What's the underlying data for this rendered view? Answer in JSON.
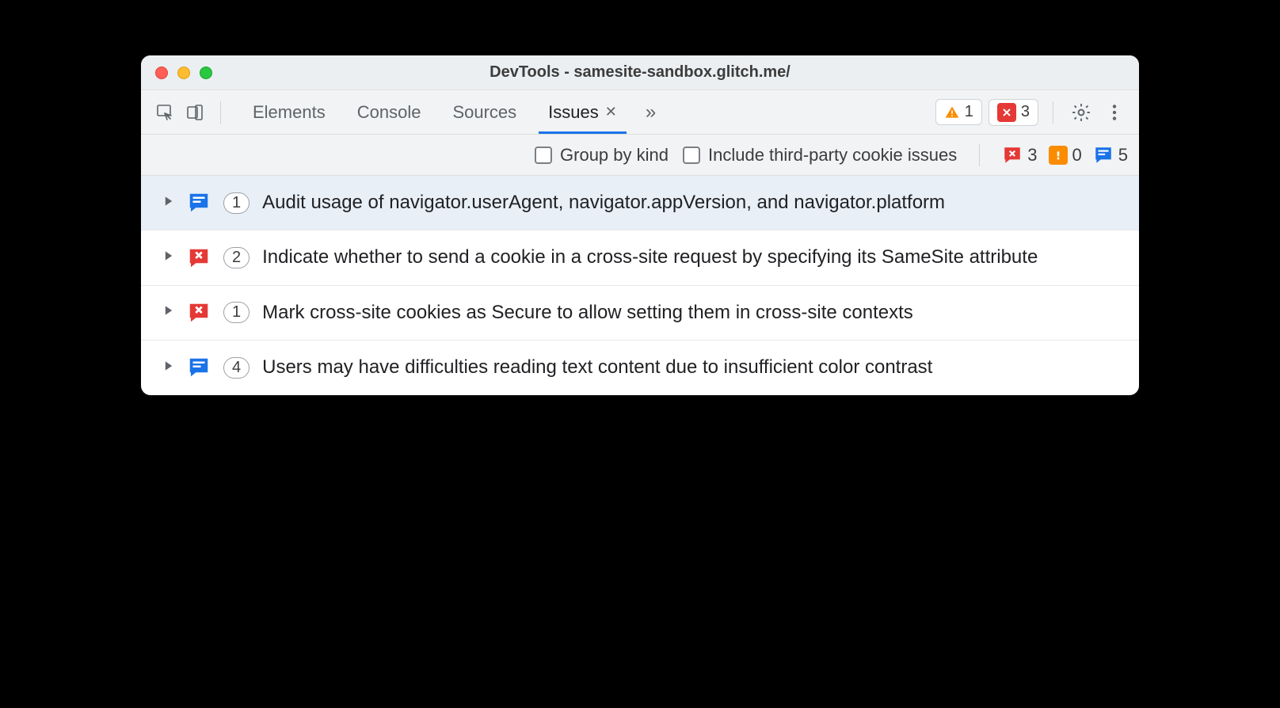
{
  "window": {
    "title": "DevTools - samesite-sandbox.glitch.me/"
  },
  "tabbar": {
    "tabs": [
      {
        "label": "Elements",
        "active": false,
        "closable": false
      },
      {
        "label": "Console",
        "active": false,
        "closable": false
      },
      {
        "label": "Sources",
        "active": false,
        "closable": false
      },
      {
        "label": "Issues",
        "active": true,
        "closable": true
      }
    ],
    "warnings_count": "1",
    "errors_count": "3"
  },
  "toolbar": {
    "group_by_kind_label": "Group by kind",
    "include_third_party_label": "Include third-party cookie issues",
    "counts": {
      "errors": "3",
      "improvements": "0",
      "info": "5"
    }
  },
  "issues": [
    {
      "kind": "info",
      "count": "1",
      "title": "Audit usage of navigator.userAgent, navigator.appVersion, and navigator.platform",
      "selected": true
    },
    {
      "kind": "error",
      "count": "2",
      "title": "Indicate whether to send a cookie in a cross-site request by specifying its SameSite attribute",
      "selected": false
    },
    {
      "kind": "error",
      "count": "1",
      "title": "Mark cross-site cookies as Secure to allow setting them in cross-site contexts",
      "selected": false
    },
    {
      "kind": "info",
      "count": "4",
      "title": "Users may have difficulties reading text content due to insufficient color contrast",
      "selected": false
    }
  ]
}
